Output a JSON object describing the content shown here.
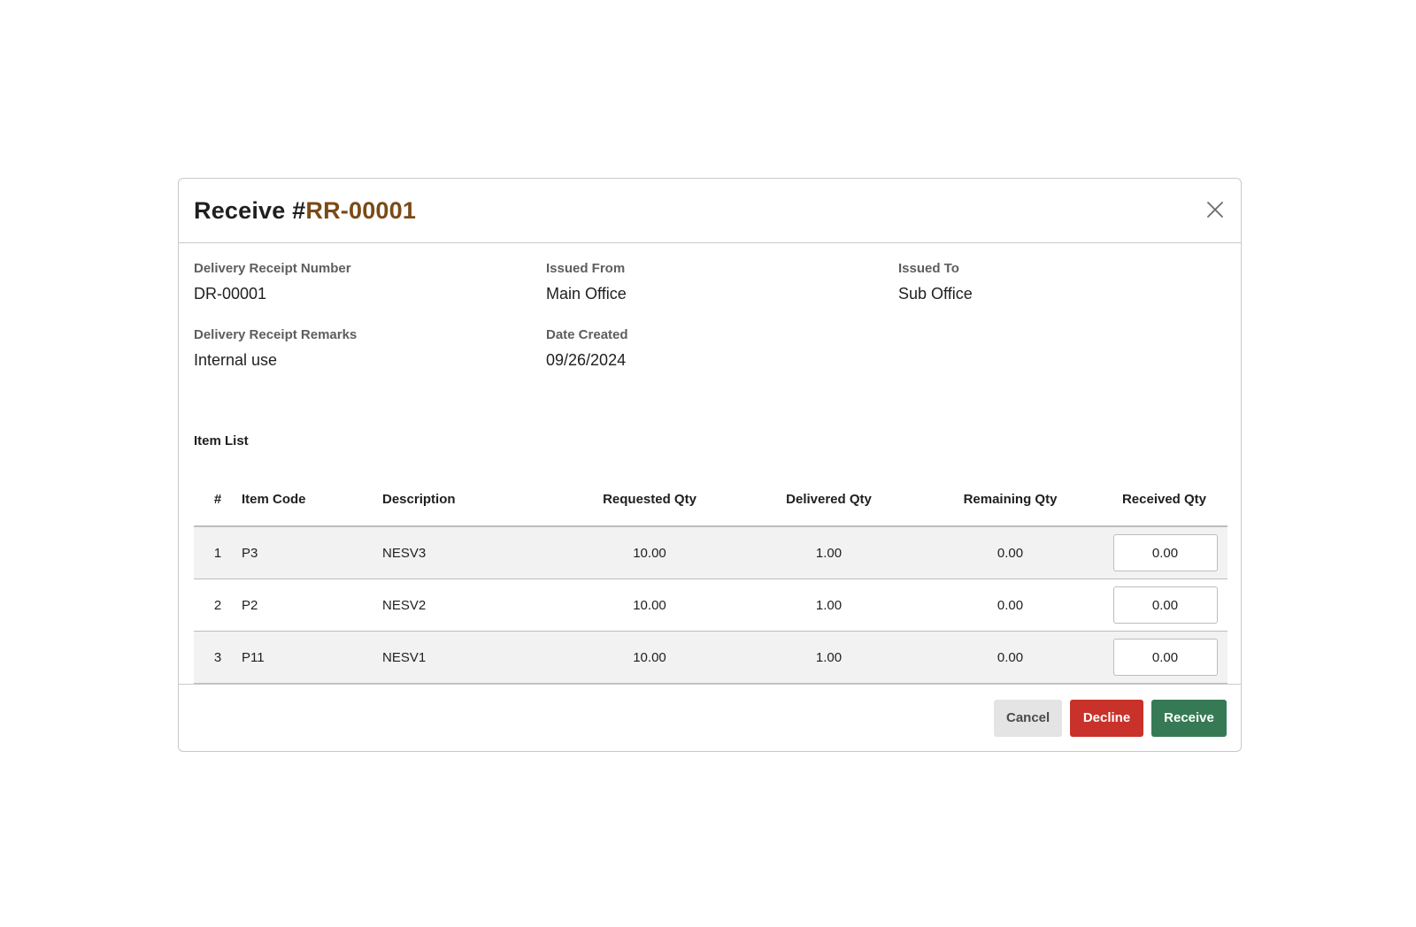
{
  "header": {
    "title_prefix": "Receive #",
    "reference": "RR-00001"
  },
  "info": {
    "delivery_receipt_number": {
      "label": "Delivery Receipt Number",
      "value": "DR-00001"
    },
    "issued_from": {
      "label": "Issued From",
      "value": "Main Office"
    },
    "issued_to": {
      "label": "Issued To",
      "value": "Sub Office"
    },
    "remarks": {
      "label": "Delivery Receipt Remarks",
      "value": "Internal use"
    },
    "date_created": {
      "label": "Date Created",
      "value": "09/26/2024"
    }
  },
  "item_list": {
    "title": "Item List",
    "columns": [
      "#",
      "Item Code",
      "Description",
      "Requested Qty",
      "Delivered Qty",
      "Remaining Qty",
      "Received Qty"
    ],
    "rows": [
      {
        "num": "1",
        "code": "P3",
        "description": "NESV3",
        "requested": "10.00",
        "delivered": "1.00",
        "remaining": "0.00",
        "received": "0.00"
      },
      {
        "num": "2",
        "code": "P2",
        "description": "NESV2",
        "requested": "10.00",
        "delivered": "1.00",
        "remaining": "0.00",
        "received": "0.00"
      },
      {
        "num": "3",
        "code": "P11",
        "description": "NESV1",
        "requested": "10.00",
        "delivered": "1.00",
        "remaining": "0.00",
        "received": "0.00"
      }
    ]
  },
  "footer": {
    "cancel_label": "Cancel",
    "decline_label": "Decline",
    "receive_label": "Receive"
  },
  "icons": {
    "close": "close-icon"
  },
  "colors": {
    "reference": "#7a4a17",
    "decline": "#c8322a",
    "receive": "#367a55",
    "cancel": "#e4e4e4"
  }
}
